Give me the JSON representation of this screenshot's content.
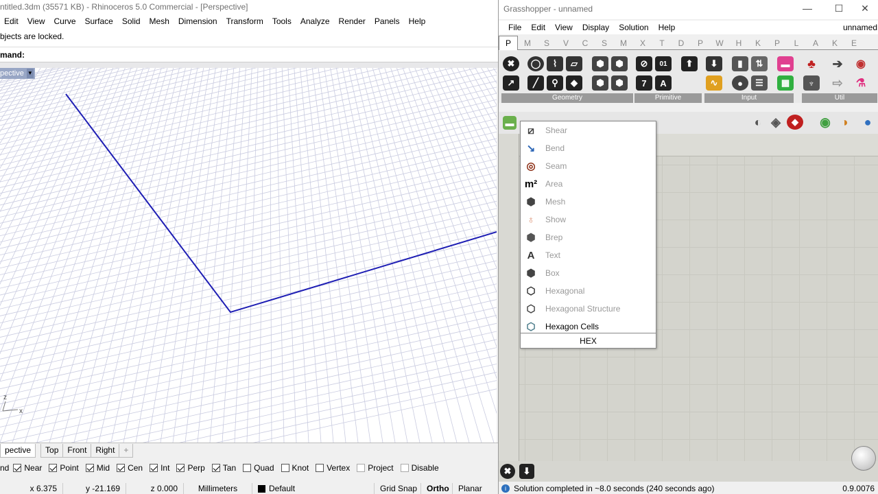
{
  "rhino": {
    "title": "ntitled.3dm (35571 KB) - Rhinoceros 5.0 Commercial - [Perspective]",
    "menu": [
      "Edit",
      "View",
      "Curve",
      "Surface",
      "Solid",
      "Mesh",
      "Dimension",
      "Transform",
      "Tools",
      "Analyze",
      "Render",
      "Panels",
      "Help"
    ],
    "command_history": "bjects are locked.",
    "command_prompt": "mand:",
    "viewport_label": "pective",
    "viewport_tabs": [
      "pective",
      "Top",
      "Front",
      "Right"
    ],
    "add_tab": "+",
    "axes": {
      "z": "z",
      "x": "x"
    },
    "osnaps": [
      {
        "label": "nd",
        "checked": true
      },
      {
        "label": "Near",
        "checked": true
      },
      {
        "label": "Point",
        "checked": true
      },
      {
        "label": "Mid",
        "checked": true
      },
      {
        "label": "Cen",
        "checked": true
      },
      {
        "label": "Int",
        "checked": true
      },
      {
        "label": "Perp",
        "checked": true
      },
      {
        "label": "Tan",
        "checked": true
      },
      {
        "label": "Quad",
        "checked": false
      },
      {
        "label": "Knot",
        "checked": false
      },
      {
        "label": "Vertex",
        "checked": false
      },
      {
        "label": "Project",
        "checked": false
      },
      {
        "label": "Disable",
        "checked": false
      }
    ],
    "status": {
      "x": "x 6.375",
      "y": "y -21.169",
      "z": "z 0.000",
      "units": "Millimeters",
      "layer": "Default",
      "grid_snap": "Grid Snap",
      "ortho": "Ortho",
      "planar": "Planar"
    },
    "colors": {
      "curve": "#1e1eb4",
      "grid": "#c9cbe0",
      "layer_swatch": "#000000"
    }
  },
  "grasshopper": {
    "title": "Grasshopper - unnamed",
    "window_controls": {
      "minimize": "—",
      "maximize": "☐",
      "close": "✕"
    },
    "menu": [
      "File",
      "Edit",
      "View",
      "Display",
      "Solution",
      "Help"
    ],
    "doc_name": "unnamed",
    "tabs": [
      "P",
      "M",
      "S",
      "V",
      "C",
      "S",
      "M",
      "X",
      "T",
      "D",
      "P",
      "W",
      "H",
      "K",
      "P",
      "L",
      "A",
      "K",
      "E"
    ],
    "ribbon_groups": [
      "Geometry",
      "Primitive",
      "Input",
      "Util"
    ],
    "status": "Solution completed in ~8.0 seconds (240 seconds ago)",
    "version": "0.9.0076",
    "search": {
      "items": [
        {
          "label": "Shear",
          "icon": "shear-icon",
          "glyph": "⧄",
          "color": "#3b3b3b"
        },
        {
          "label": "Bend",
          "icon": "bend-icon",
          "glyph": "↘",
          "color": "#2a64b5"
        },
        {
          "label": "Seam",
          "icon": "seam-icon",
          "glyph": "◎",
          "color": "#8a2a10"
        },
        {
          "label": "Area",
          "icon": "area-icon",
          "glyph": "m²",
          "color": "#000000"
        },
        {
          "label": "Mesh",
          "icon": "mesh-icon",
          "glyph": "⬢",
          "color": "#444444"
        },
        {
          "label": "Show",
          "icon": "show-icon",
          "glyph": "♁",
          "color": "#d98a6a"
        },
        {
          "label": "Brep",
          "icon": "brep-icon",
          "glyph": "⬢",
          "color": "#555555"
        },
        {
          "label": "Text",
          "icon": "text-icon",
          "glyph": "A",
          "color": "#333333"
        },
        {
          "label": "Box",
          "icon": "box-icon",
          "glyph": "⬢",
          "color": "#444444"
        },
        {
          "label": "Hexagonal",
          "icon": "hexagonal-icon",
          "glyph": "⬡",
          "color": "#333333"
        },
        {
          "label": "Hexagonal Structure",
          "icon": "hexagonal-structure-icon",
          "glyph": "⬡",
          "color": "#444444"
        },
        {
          "label": "Hexagon Cells",
          "icon": "hexagon-cells-icon",
          "glyph": "⬡",
          "color": "#4a7b8a"
        }
      ],
      "query": "HEX"
    }
  }
}
